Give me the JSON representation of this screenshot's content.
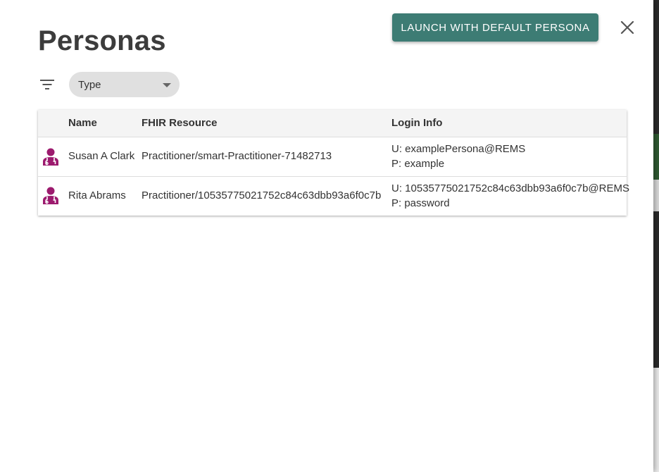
{
  "dialog": {
    "title": "Personas",
    "launch_button_label": "LAUNCH WITH DEFAULT PERSONA",
    "close_icon": "close-icon",
    "accent_color": "#3d7c74",
    "persona_icon_color": "#9c1a6e"
  },
  "filter": {
    "filter_icon": "filter-list-icon",
    "type_select_label": "Type",
    "type_select_icon": "arrow-drop-down-icon"
  },
  "table": {
    "headers": [
      "",
      "Name",
      "FHIR Resource",
      "Login Info"
    ],
    "rows": [
      {
        "icon": "doctor-icon",
        "name": "Susan A Clark",
        "fhir_resource": "Practitioner/smart-Practitioner-71482713",
        "login_user": "U: examplePersona@REMS",
        "login_password": "P: example"
      },
      {
        "icon": "doctor-icon",
        "name": "Rita Abrams",
        "fhir_resource": "Practitioner/10535775021752c84c63dbb93a6f0c7b",
        "login_user": "U: 10535775021752c84c63dbb93a6f0c7b@REMS",
        "login_password": "P: password"
      }
    ]
  }
}
